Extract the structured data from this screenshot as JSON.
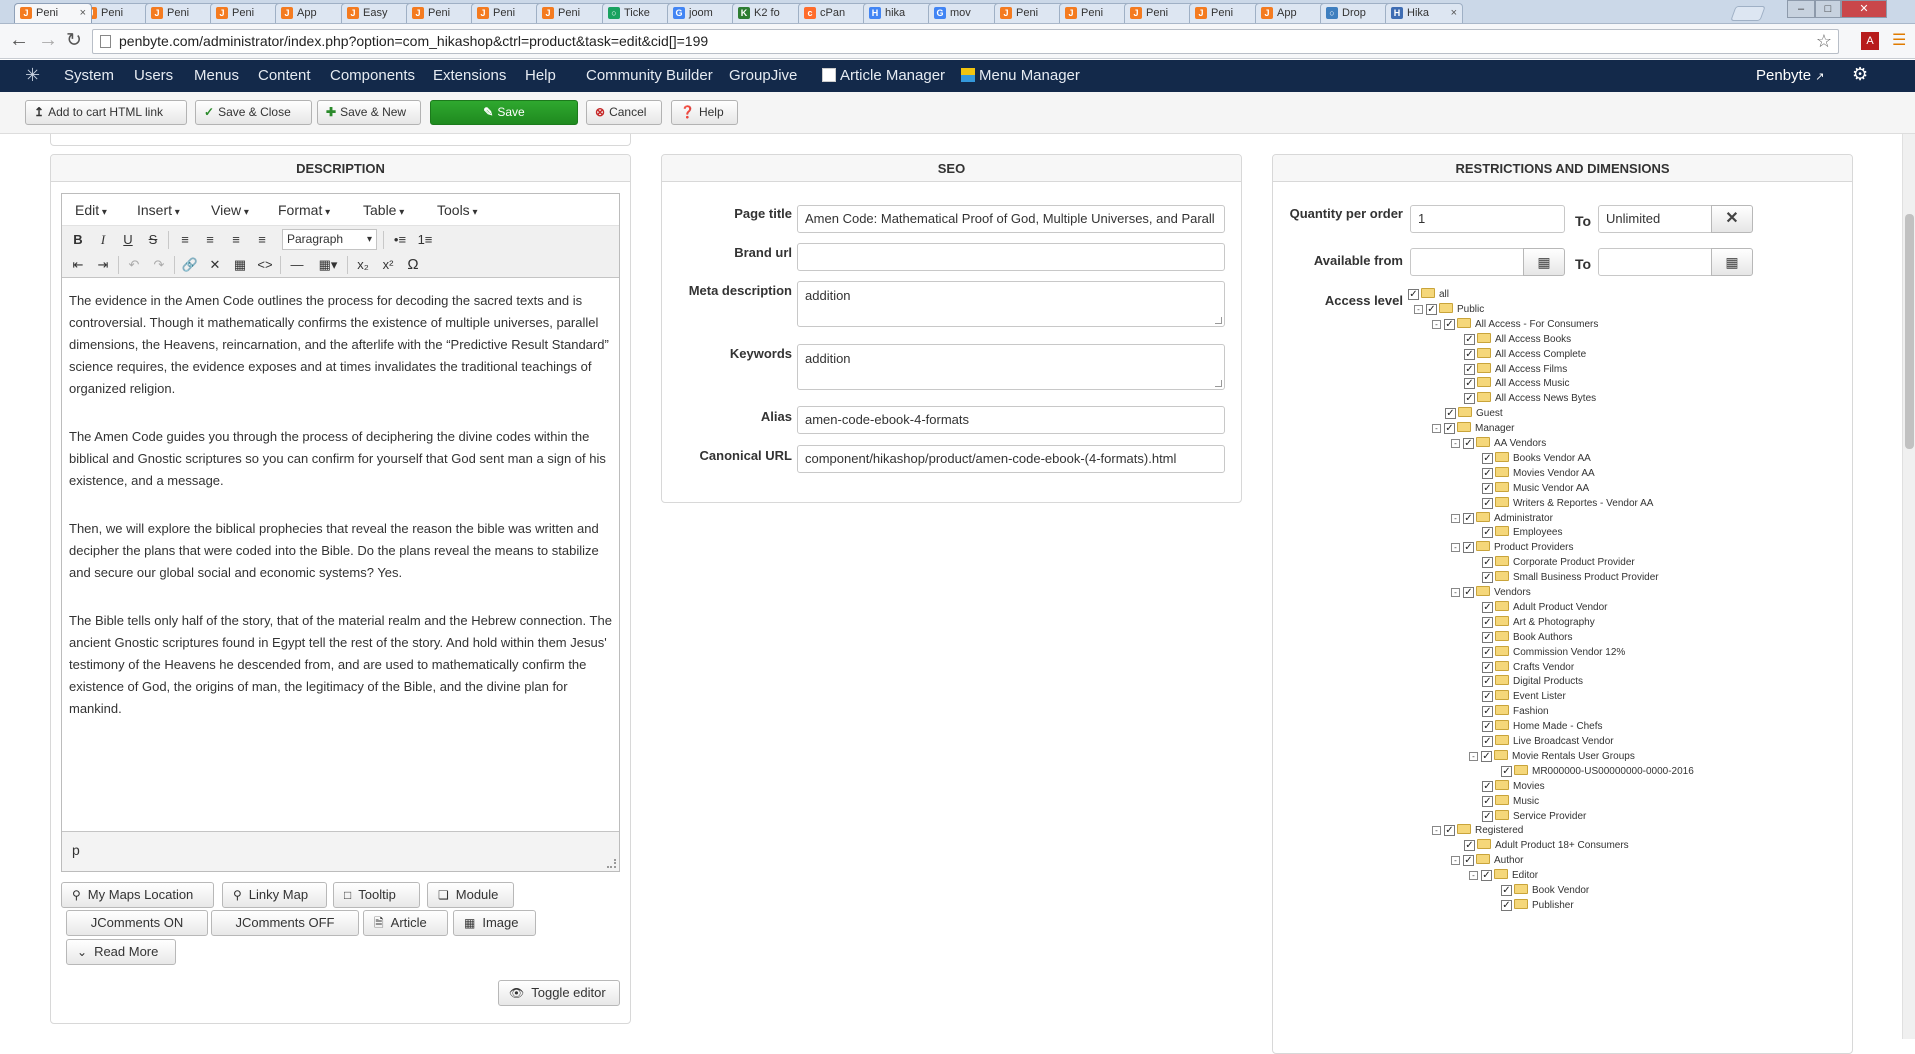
{
  "browser": {
    "tabs": [
      {
        "label": "Peni",
        "fav": "J",
        "color": "#f47b20",
        "active": true
      },
      {
        "label": "Peni",
        "fav": "J",
        "color": "#f47b20"
      },
      {
        "label": "Peni",
        "fav": "J",
        "color": "#f47b20"
      },
      {
        "label": "Peni",
        "fav": "J",
        "color": "#f47b20"
      },
      {
        "label": "App",
        "fav": "J",
        "color": "#f47b20"
      },
      {
        "label": "Easy",
        "fav": "J",
        "color": "#f47b20"
      },
      {
        "label": "Peni",
        "fav": "J",
        "color": "#f47b20"
      },
      {
        "label": "Peni",
        "fav": "J",
        "color": "#f47b20"
      },
      {
        "label": "Peni",
        "fav": "J",
        "color": "#f47b20"
      },
      {
        "label": "Ticke",
        "fav": "○",
        "color": "#1aa260"
      },
      {
        "label": "joom",
        "fav": "G",
        "color": "#4285f4"
      },
      {
        "label": "K2 fo",
        "fav": "K",
        "color": "#2e7d32"
      },
      {
        "label": "cPan",
        "fav": "c",
        "color": "#ff6c2c"
      },
      {
        "label": "hika",
        "fav": "H",
        "color": "#4285f4"
      },
      {
        "label": "mov",
        "fav": "G",
        "color": "#4285f4"
      },
      {
        "label": "Peni",
        "fav": "J",
        "color": "#f47b20"
      },
      {
        "label": "Peni",
        "fav": "J",
        "color": "#f47b20"
      },
      {
        "label": "Peni",
        "fav": "J",
        "color": "#f47b20"
      },
      {
        "label": "Peni",
        "fav": "J",
        "color": "#f47b20"
      },
      {
        "label": "App",
        "fav": "J",
        "color": "#f47b20"
      },
      {
        "label": "Drop",
        "fav": "○",
        "color": "#3f7fbf"
      },
      {
        "label": "Hika",
        "fav": "H",
        "color": "#3f6db3"
      }
    ],
    "url": "penbyte.com/administrator/index.php?option=com_hikashop&ctrl=product&task=edit&cid[]=199"
  },
  "joomla_nav": {
    "items": [
      "System",
      "Users",
      "Menus",
      "Content",
      "Components",
      "Extensions",
      "Help"
    ],
    "extra": [
      "Community Builder",
      "GroupJive"
    ],
    "article_manager": "Article Manager",
    "menu_manager": "Menu Manager",
    "user": "Penbyte"
  },
  "toolbar": {
    "add_to_cart": "Add to cart HTML link",
    "save_close": "Save & Close",
    "save_new": "Save & New",
    "save": "Save",
    "cancel": "Cancel",
    "help": "Help"
  },
  "description": {
    "title": "DESCRIPTION",
    "menus": [
      "Edit",
      "Insert",
      "View",
      "Format",
      "Table",
      "Tools"
    ],
    "paragraph_select": "Paragraph",
    "paragraphs": [
      "The evidence in the Amen Code outlines the process for decoding the sacred texts and is controversial. Though it mathematically confirms the existence of multiple universes, parallel dimensions, the Heavens, reincarnation, and the afterlife with the “Predictive Result Standard” science requires, the evidence exposes and at times invalidates the traditional teachings of organized religion.",
      "The Amen Code guides you through the process of deciphering the divine codes within the biblical and Gnostic scriptures so you can confirm for yourself that God sent man a sign of his existence, and a message.",
      "Then, we will explore the biblical prophecies that reveal the reason the bible was written and decipher the plans that were coded into the Bible. Do the plans reveal the means to stabilize and secure our global social and economic systems? Yes.",
      "The Bible tells only half of the story, that of the material realm and the Hebrew connection. The ancient Gnostic scriptures found in Egypt tell the rest of the story. And hold within them Jesus' testimony of the Heavens he descended from, and are used to mathematically confirm the existence of God, the origins of man, the legitimacy of the Bible, and the divine plan for mankind."
    ],
    "status_path": "p",
    "buttons": {
      "my_maps": "My Maps Location",
      "linky_map": "Linky Map",
      "tooltip": "Tooltip",
      "module": "Module",
      "jcomments_on": "JComments ON",
      "jcomments_off": "JComments OFF",
      "article": "Article",
      "image": "Image",
      "read_more": "Read More",
      "toggle_editor": "Toggle editor"
    }
  },
  "seo": {
    "title": "SEO",
    "page_title_label": "Page title",
    "page_title_value": "Amen Code: Mathematical Proof of God, Multiple Universes, and Parall",
    "brand_url_label": "Brand url",
    "brand_url_value": "",
    "meta_label": "Meta description",
    "meta_value": "addition",
    "keywords_label": "Keywords",
    "keywords_value": "addition",
    "alias_label": "Alias",
    "alias_value": "amen-code-ebook-4-formats",
    "canonical_label": "Canonical URL",
    "canonical_value": "component/hikashop/product/amen-code-ebook-(4-formats).html"
  },
  "restrictions": {
    "title": "RESTRICTIONS AND DIMENSIONS",
    "qty_label": "Quantity per order",
    "qty_from": "1",
    "to_label": "To",
    "qty_to": "Unlimited",
    "available_label": "Available from",
    "available_from": "",
    "available_to": "",
    "access_label": "Access level",
    "tree": [
      {
        "label": "all",
        "depth": 0,
        "tog": ""
      },
      {
        "label": "Public",
        "depth": 1,
        "tog": "-"
      },
      {
        "label": "All Access - For Consumers",
        "depth": 2,
        "tog": "-"
      },
      {
        "label": "All Access Books",
        "depth": 3,
        "tog": ""
      },
      {
        "label": "All Access Complete",
        "depth": 3,
        "tog": ""
      },
      {
        "label": "All Access Films",
        "depth": 3,
        "tog": ""
      },
      {
        "label": "All Access Music",
        "depth": 3,
        "tog": ""
      },
      {
        "label": "All Access News Bytes",
        "depth": 3,
        "tog": ""
      },
      {
        "label": "Guest",
        "depth": 2,
        "tog": ""
      },
      {
        "label": "Manager",
        "depth": 2,
        "tog": "-"
      },
      {
        "label": "AA Vendors",
        "depth": 3,
        "tog": "-"
      },
      {
        "label": "Books Vendor AA",
        "depth": 4,
        "tog": ""
      },
      {
        "label": "Movies Vendor AA",
        "depth": 4,
        "tog": ""
      },
      {
        "label": "Music Vendor AA",
        "depth": 4,
        "tog": ""
      },
      {
        "label": "Writers & Reportes - Vendor AA",
        "depth": 4,
        "tog": ""
      },
      {
        "label": "Administrator",
        "depth": 3,
        "tog": "-"
      },
      {
        "label": "Employees",
        "depth": 4,
        "tog": ""
      },
      {
        "label": "Product Providers",
        "depth": 3,
        "tog": "-"
      },
      {
        "label": "Corporate Product Provider",
        "depth": 4,
        "tog": ""
      },
      {
        "label": "Small Business Product Provider",
        "depth": 4,
        "tog": ""
      },
      {
        "label": "Vendors",
        "depth": 3,
        "tog": "-"
      },
      {
        "label": "Adult Product Vendor",
        "depth": 4,
        "tog": ""
      },
      {
        "label": "Art & Photography",
        "depth": 4,
        "tog": ""
      },
      {
        "label": "Book Authors",
        "depth": 4,
        "tog": ""
      },
      {
        "label": "Commission Vendor 12%",
        "depth": 4,
        "tog": ""
      },
      {
        "label": "Crafts Vendor",
        "depth": 4,
        "tog": ""
      },
      {
        "label": "Digital Products",
        "depth": 4,
        "tog": ""
      },
      {
        "label": "Event Lister",
        "depth": 4,
        "tog": ""
      },
      {
        "label": "Fashion",
        "depth": 4,
        "tog": ""
      },
      {
        "label": "Home Made - Chefs",
        "depth": 4,
        "tog": ""
      },
      {
        "label": "Live Broadcast Vendor",
        "depth": 4,
        "tog": ""
      },
      {
        "label": "Movie Rentals User Groups",
        "depth": 4,
        "tog": "-"
      },
      {
        "label": "MR000000-US00000000-0000-2016",
        "depth": 5,
        "tog": ""
      },
      {
        "label": "Movies",
        "depth": 4,
        "tog": ""
      },
      {
        "label": "Music",
        "depth": 4,
        "tog": ""
      },
      {
        "label": "Service Provider",
        "depth": 4,
        "tog": ""
      },
      {
        "label": "Registered",
        "depth": 2,
        "tog": "-"
      },
      {
        "label": "Adult Product 18+ Consumers",
        "depth": 3,
        "tog": ""
      },
      {
        "label": "Author",
        "depth": 3,
        "tog": "-"
      },
      {
        "label": "Editor",
        "depth": 4,
        "tog": "-"
      },
      {
        "label": "Book Vendor",
        "depth": 5,
        "tog": ""
      },
      {
        "label": "Publisher",
        "depth": 5,
        "tog": ""
      }
    ]
  }
}
